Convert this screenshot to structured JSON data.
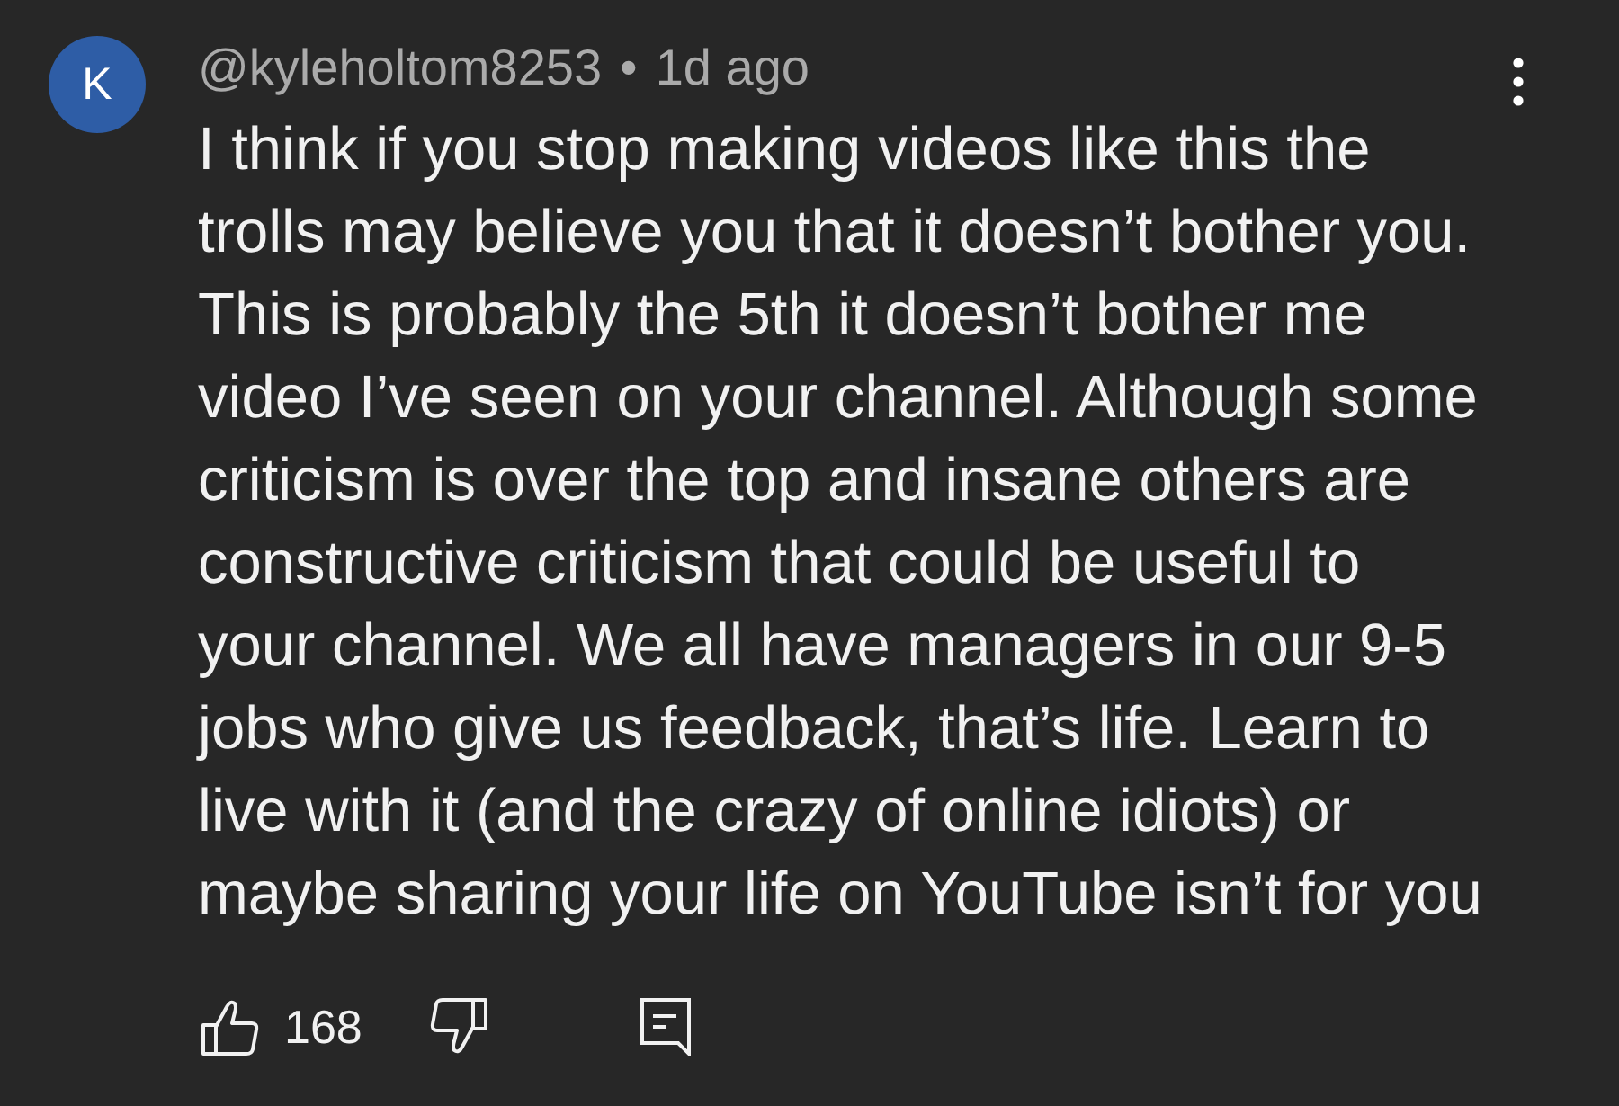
{
  "comment": {
    "avatar_letter": "K",
    "handle": "@kyleholtom8253",
    "separator": "•",
    "time": "1d ago",
    "body_lines": [
      "I think if you stop making videos like this the",
      "trolls may believe you that it doesn’t bother you.",
      "This is probably the 5th it doesn’t bother me",
      "video I’ve seen on your channel. Although some",
      "criticism is over the top and insane others are",
      "constructive criticism that could be useful to",
      "your channel. We all have managers in our 9-5",
      "jobs who give us feedback, that’s life. Learn to",
      "live with it (and the crazy of online idiots) or",
      "maybe sharing your life on YouTube isn’t for you"
    ]
  },
  "actions": {
    "like_count": "168"
  }
}
